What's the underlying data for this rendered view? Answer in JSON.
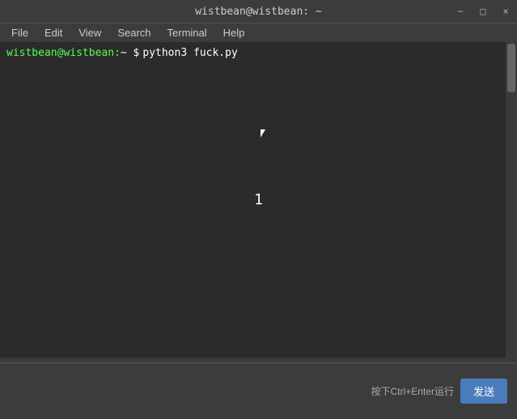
{
  "titleBar": {
    "title": "wistbean@wistbean: ~",
    "controls": {
      "minimize": "−",
      "maximize": "□",
      "close": "×"
    }
  },
  "menuBar": {
    "items": [
      "File",
      "Edit",
      "View",
      "Search",
      "Terminal",
      "Help"
    ]
  },
  "terminal": {
    "prompt": {
      "user": "wistbean@wistbean:",
      "path": "~",
      "dollar": "$",
      "command": "python3 fuck.py"
    },
    "output": "1"
  },
  "bottomBar": {
    "hint": "按下Ctrl+Enter运行",
    "sendLabel": "发送"
  }
}
